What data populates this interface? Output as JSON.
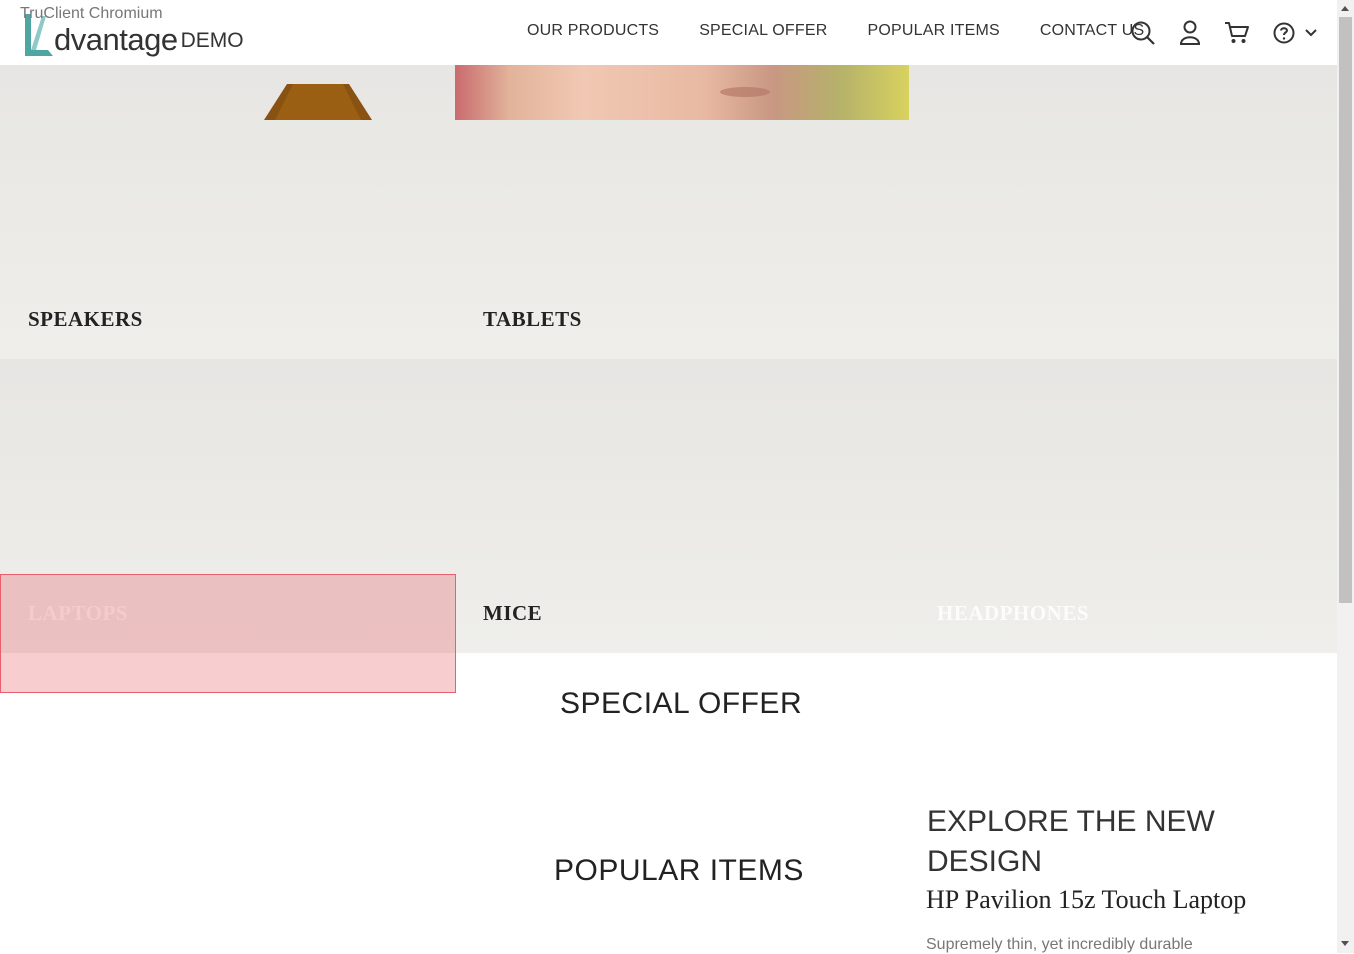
{
  "app": {
    "title": "TruClient Chromium"
  },
  "logo": {
    "text": "dvantage",
    "suffix": "DEMO"
  },
  "nav": {
    "items": [
      "OUR PRODUCTS",
      "SPECIAL OFFER",
      "POPULAR ITEMS",
      "CONTACT US"
    ]
  },
  "icons": [
    "search-icon",
    "user-icon",
    "cart-icon",
    "help-icon",
    "chevron-down-icon"
  ],
  "categories": {
    "speakers": "SPEAKERS",
    "tablets": "TABLETS",
    "laptops": "LAPTOPS",
    "mice": "MICE",
    "headphones": "HEADPHONES"
  },
  "sections": {
    "special_offer": "SPECIAL OFFER",
    "popular_items": "POPULAR ITEMS"
  },
  "promo": {
    "headline": "EXPLORE THE NEW DESIGN",
    "product_name": "HP Pavilion 15z Touch Laptop",
    "description": "Supremely thin, yet incredibly durable"
  },
  "colors": {
    "accent": "#4ea6a3",
    "highlight_border": "#e66070"
  }
}
